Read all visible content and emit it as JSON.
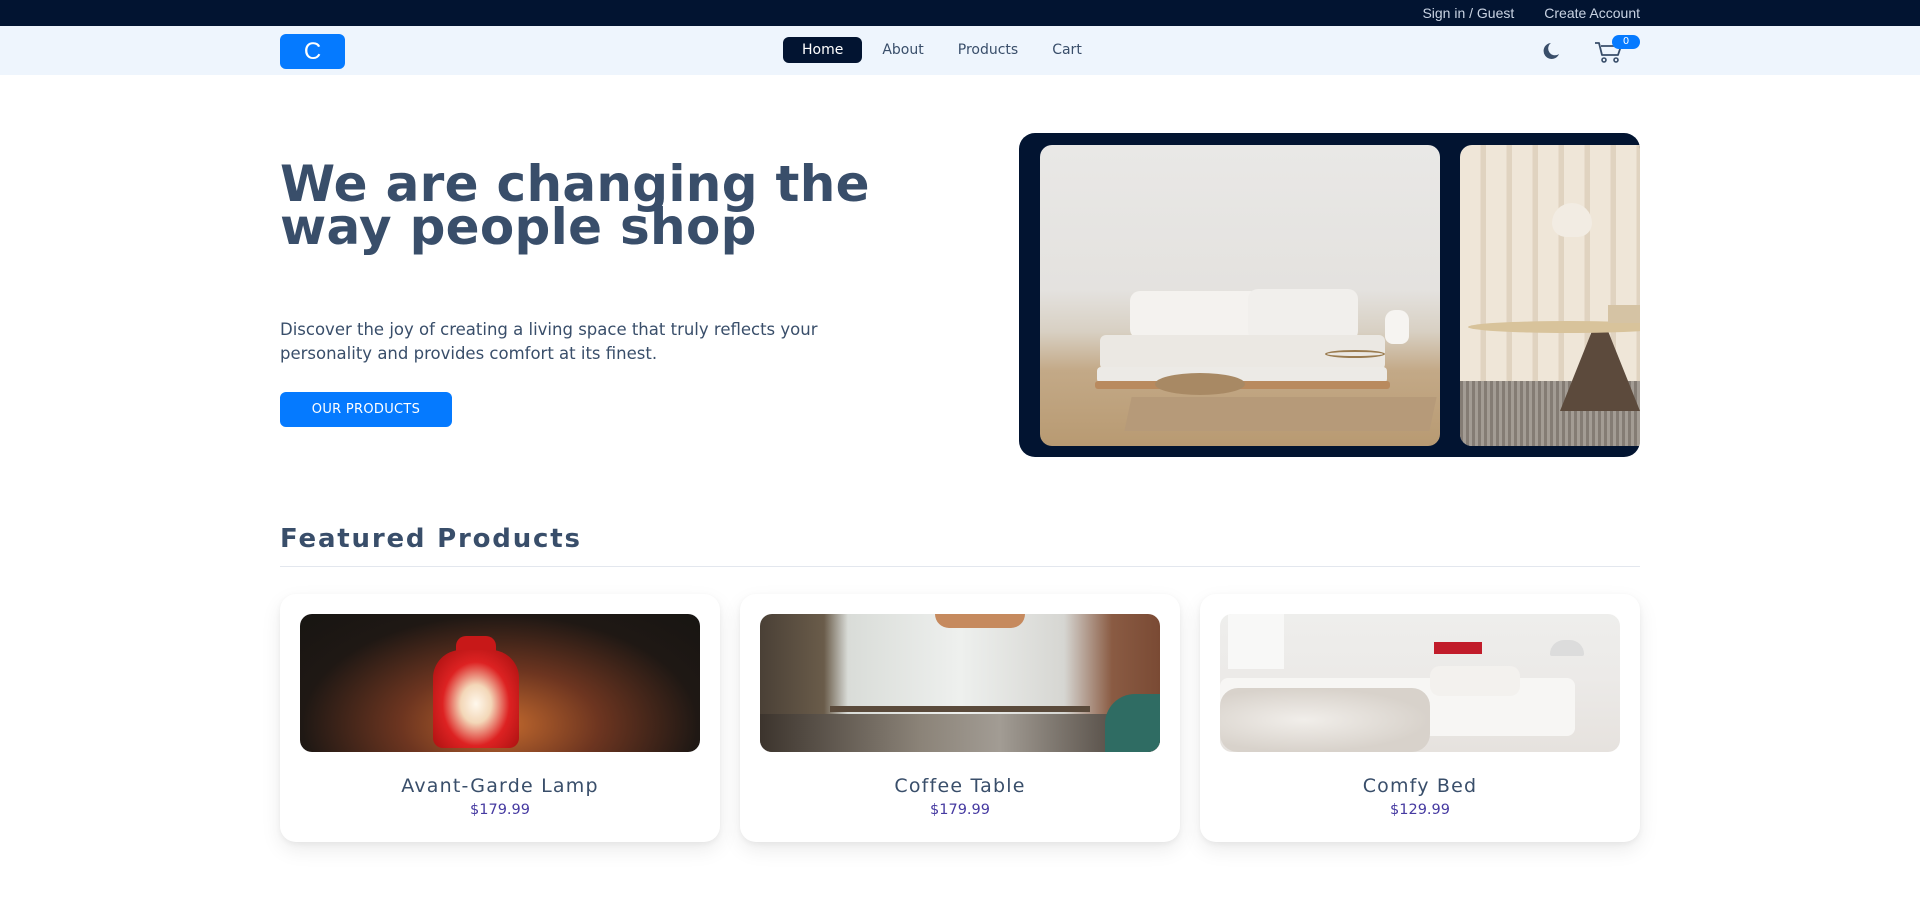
{
  "topbar": {
    "signin": "Sign in / Guest",
    "create_account": "Create Account"
  },
  "navbar": {
    "logo_letter": "C",
    "links": [
      "Home",
      "About",
      "Products",
      "Cart"
    ],
    "active": "Home",
    "theme_icon": "moon-icon",
    "cart_icon": "cart-icon",
    "cart_count": "0"
  },
  "hero": {
    "title": "We are changing the way people shop",
    "description": "Discover the joy of creating a living space that truly reflects your personality and provides comfort at its finest.",
    "button": "OUR PRODUCTS"
  },
  "featured": {
    "title": "Featured Products",
    "products": [
      {
        "name": "Avant-Garde Lamp",
        "price": "$179.99"
      },
      {
        "name": "Coffee Table",
        "price": "$179.99"
      },
      {
        "name": "Comfy Bed",
        "price": "$129.99"
      }
    ]
  },
  "colors": {
    "primary": "#057aff",
    "dark": "#021431",
    "nav_bg": "#eef5fd",
    "text": "#394e6a",
    "price": "#463aa1"
  }
}
